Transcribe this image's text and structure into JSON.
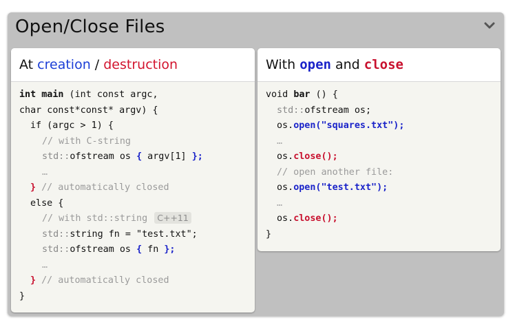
{
  "panel": {
    "title": "Open/Close Files",
    "collapse_icon": "chevron-down-icon"
  },
  "left_card": {
    "head": {
      "at": "At",
      "creation": "creation",
      "slash": "/",
      "destruction": "destruction"
    },
    "code": {
      "l1_kw": "int",
      "l1_fn": "main",
      "l1_rest": " (int const argc,",
      "l2": "char const*const* argv) {",
      "l3": "if (argc > 1) {",
      "l4": "// with C-string",
      "l5_ns": "std::",
      "l5_type": "ofstream os ",
      "l5_ob": "{",
      "l5_arg": " argv[1] ",
      "l5_cb": "};",
      "l6": "…",
      "l7_brace": "}",
      "l7_comment": " // automatically closed",
      "l8": "else {",
      "l9_comment": "// with std::string",
      "l9_badge": "C++11",
      "l10_ns": "std::",
      "l10_rest": "string fn = \"test.txt\";",
      "l11_ns": "std::",
      "l11_type": "ofstream os ",
      "l11_ob": "{",
      "l11_arg": " fn ",
      "l11_cb": "};",
      "l12": "…",
      "l13_brace": "}",
      "l13_comment": " // automatically closed",
      "l14": "}"
    }
  },
  "right_card": {
    "head": {
      "with": "With",
      "open": "open",
      "and": "and",
      "close": "close"
    },
    "code": {
      "l1_kw": "void",
      "l1_fn": "bar",
      "l1_rest": " () {",
      "l2_ns": "std::",
      "l2_rest": "ofstream os;",
      "l3_obj": "os.",
      "l3_fn": "open(\"squares.txt\");",
      "l4": "…",
      "l5_obj": "os.",
      "l5_fn": "close();",
      "l6": "// open another file:",
      "l7_obj": "os.",
      "l7_fn": "open(\"test.txt\");",
      "l8": "…",
      "l9_obj": "os.",
      "l9_fn": "close();",
      "l10": "}"
    }
  }
}
